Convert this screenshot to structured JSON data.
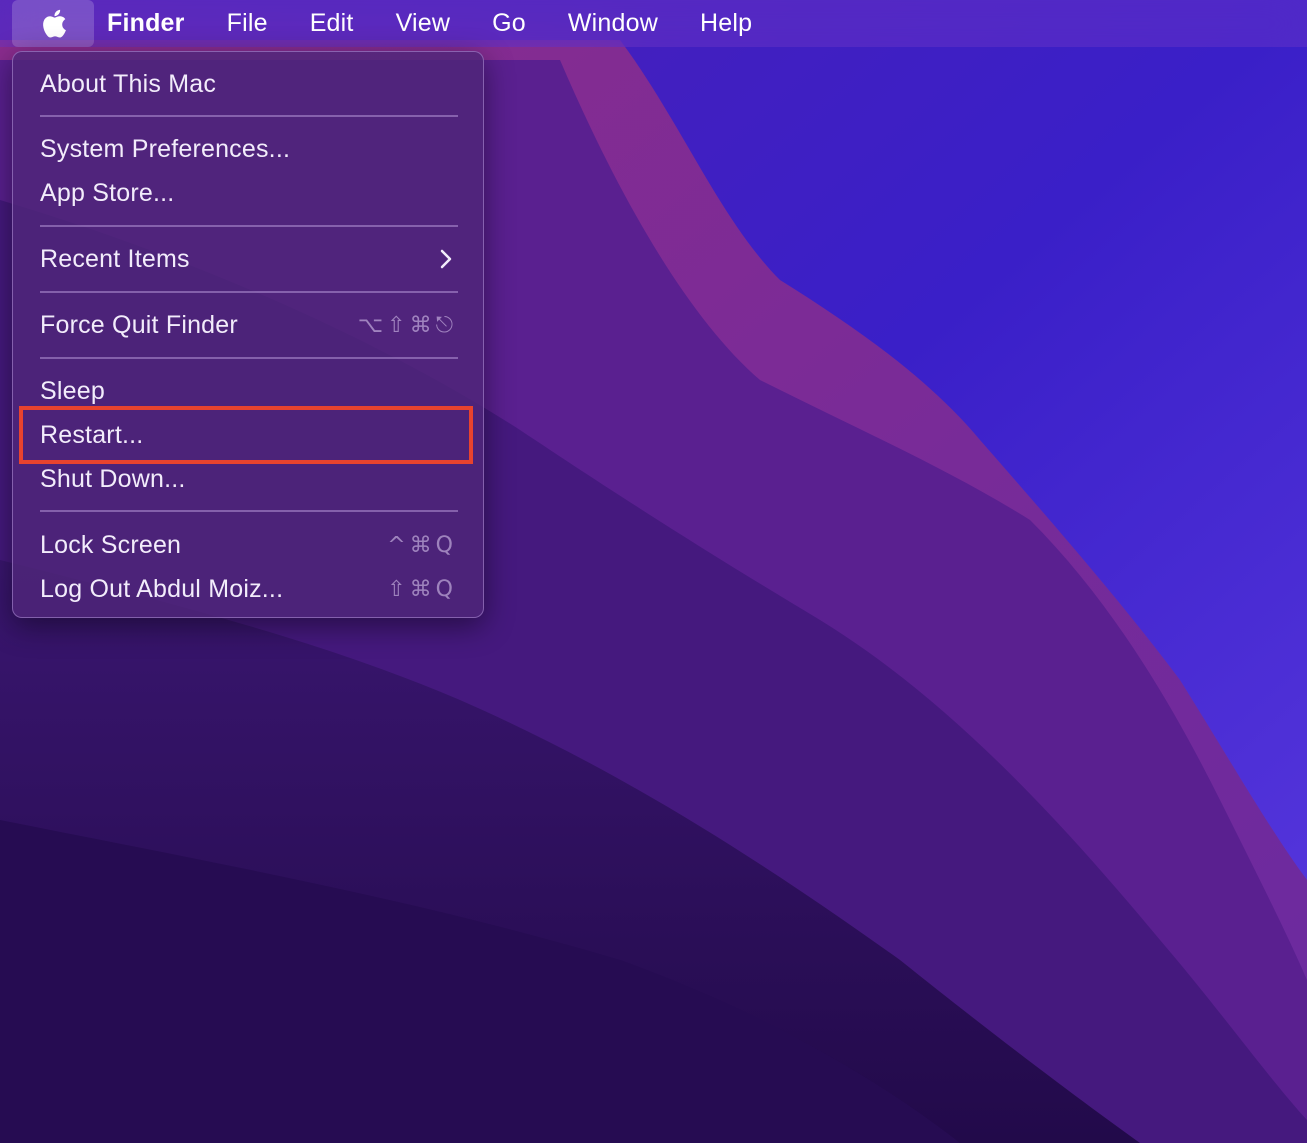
{
  "menubar": {
    "apple_icon": "apple-logo-icon",
    "items": [
      {
        "label": "Finder"
      },
      {
        "label": "File"
      },
      {
        "label": "Edit"
      },
      {
        "label": "View"
      },
      {
        "label": "Go"
      },
      {
        "label": "Window"
      },
      {
        "label": "Help"
      }
    ]
  },
  "apple_menu": {
    "about": "About This Mac",
    "system_preferences": "System Preferences...",
    "app_store": "App Store...",
    "recent_items": "Recent Items",
    "recent_items_icon": "chevron-right-icon",
    "force_quit": "Force Quit Finder",
    "force_quit_shortcut": "⌥⇧⌘⎋",
    "sleep": "Sleep",
    "restart": "Restart...",
    "shut_down": "Shut Down...",
    "lock_screen": "Lock Screen",
    "lock_screen_shortcut": "^⌘Q",
    "log_out": "Log Out Abdul Moiz...",
    "log_out_shortcut": "⇧⌘Q"
  },
  "highlight": {
    "target": "restart",
    "color": "#e8432e"
  },
  "colors": {
    "wallpaper_dark": "#2a0d5a",
    "wallpaper_mid": "#4a1a8a",
    "wallpaper_magenta": "#7a2a9a",
    "wallpaper_blue": "#3b22c9"
  }
}
